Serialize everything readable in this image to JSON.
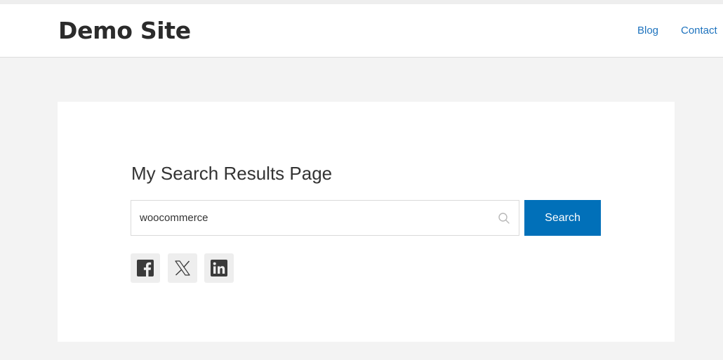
{
  "header": {
    "site_title": "Demo Site",
    "nav": [
      {
        "label": "Blog"
      },
      {
        "label": "Contact"
      }
    ]
  },
  "main": {
    "page_title": "My Search Results Page",
    "search": {
      "value": "woocommerce",
      "button_label": "Search",
      "icon": "search-icon"
    },
    "social": [
      {
        "icon": "facebook-icon"
      },
      {
        "icon": "x-twitter-icon"
      },
      {
        "icon": "linkedin-icon"
      }
    ]
  },
  "colors": {
    "accent": "#0170b9",
    "nav_link": "#1e73be",
    "background": "#f3f3f3",
    "social_icon": "#3a3a3a"
  }
}
